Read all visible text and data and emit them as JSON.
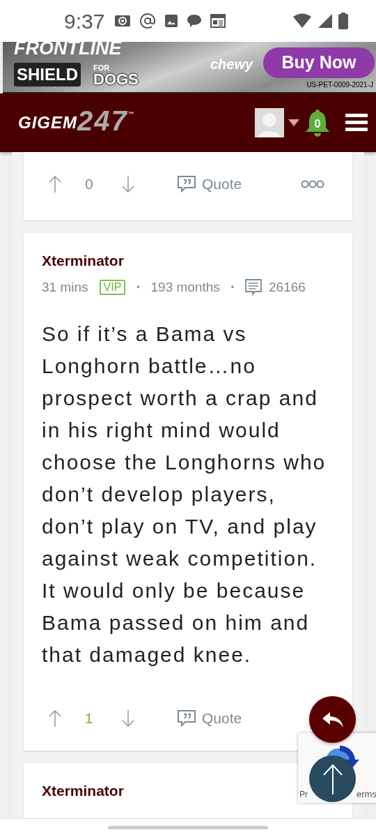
{
  "status_bar": {
    "time": "9:37"
  },
  "ad": {
    "brand_line1": "FRONTLINE",
    "brand_shield": "SHIELD",
    "brand_for": "FOR",
    "brand_dogs": "DOGS",
    "retailer": "chewy",
    "button": "Buy Now",
    "code": "US-PET-0009-2021-J"
  },
  "header": {
    "logo_text": "GIGEM",
    "logo_number": "247",
    "logo_mark": "™",
    "notifications": "0"
  },
  "posts": [
    {
      "actions": {
        "upvotes": "0",
        "upvoted": false,
        "quote": "Quote",
        "more": true
      }
    },
    {
      "author": "Xterminator",
      "time": "31 mins",
      "badge": "VIP",
      "separator_1": "•",
      "tenure": "193 months",
      "separator_2": "•",
      "post_count": "26166",
      "body": "So if it’s a Bama vs Longhorn battle…no prospect worth a crap and in his right mind would choose the Longhorns who don’t develop players, don’t play on TV, and play against weak competition. It would only be because Bama passed on him and that damaged knee.",
      "actions": {
        "upvotes": "1",
        "upvoted": true,
        "quote": "Quote"
      }
    },
    {
      "author": "Xterminator"
    }
  ],
  "recaptcha": {
    "left_text": "Pr",
    "right_text": "erms"
  }
}
